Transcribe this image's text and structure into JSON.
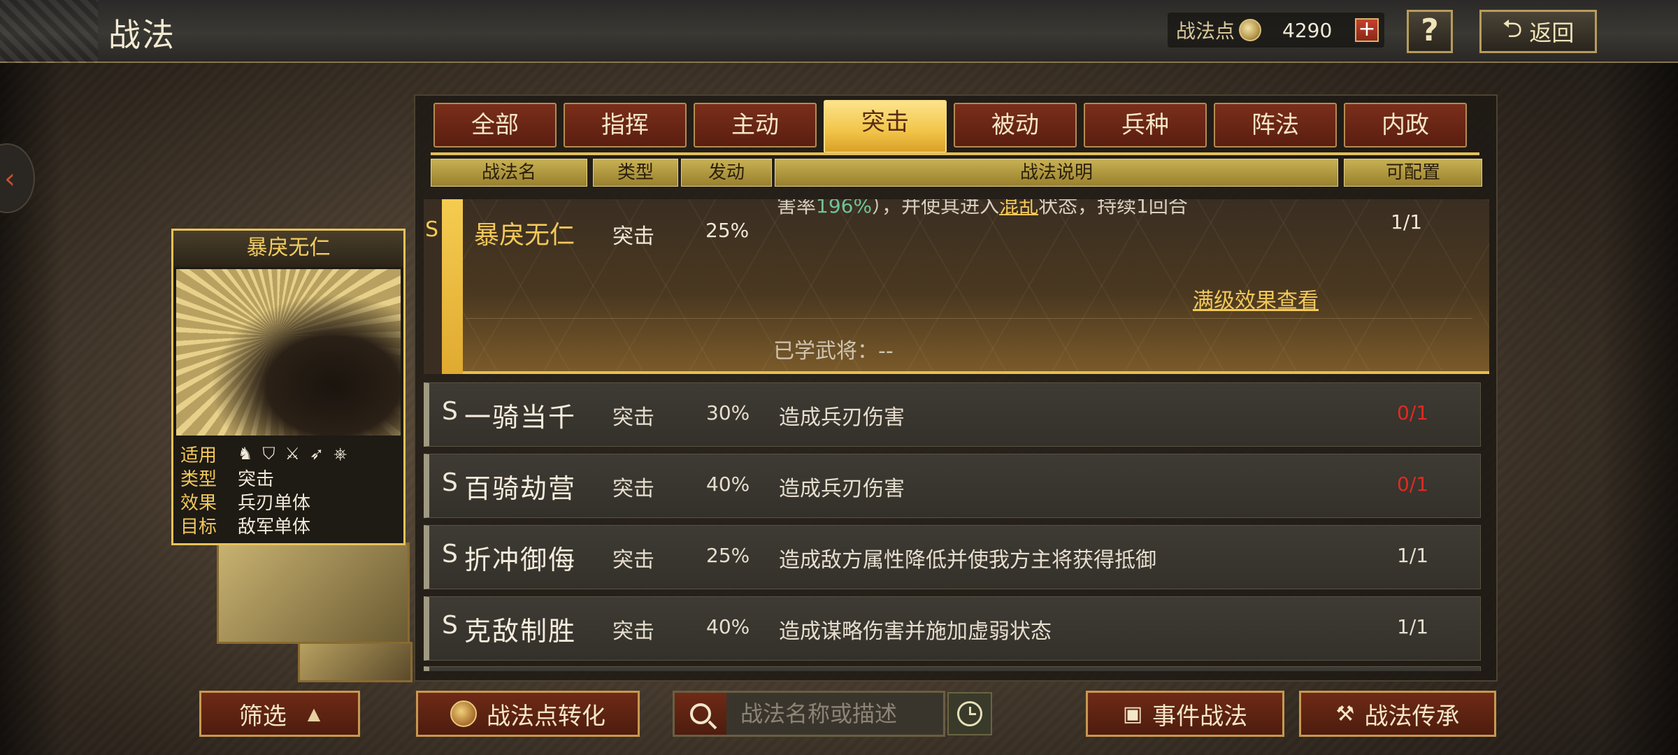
{
  "header": {
    "title": "战法",
    "points_label": "战法点",
    "points_value": "4290",
    "plus_label": "+",
    "help_label": "?",
    "back_label": "返回"
  },
  "tabs": [
    {
      "label": "全部"
    },
    {
      "label": "指挥"
    },
    {
      "label": "主动"
    },
    {
      "label": "突击",
      "active": true
    },
    {
      "label": "被动"
    },
    {
      "label": "兵种"
    },
    {
      "label": "阵法"
    },
    {
      "label": "内政"
    }
  ],
  "columns": {
    "name": "战法名",
    "type": "类型",
    "trigger": "发动",
    "desc": "战法说明",
    "config": "可配置"
  },
  "expanded": {
    "grade": "S",
    "name": "暴戾无仁",
    "type": "突击",
    "rate": "25%",
    "desc_a": "害率",
    "desc_pct": "196%",
    "desc_b": "），并使其进入",
    "desc_status": "混乱",
    "desc_c": "状态，持续1回合",
    "config": "1/1",
    "max_level_link": "满级效果查看",
    "learned_label": "已学武将：--"
  },
  "rows": [
    {
      "grade": "S",
      "name": "一骑当千",
      "type": "突击",
      "rate": "30%",
      "desc": "造成兵刃伤害",
      "config": "0/1"
    },
    {
      "grade": "S",
      "name": "百骑劫营",
      "type": "突击",
      "rate": "40%",
      "desc": "造成兵刃伤害",
      "config": "0/1"
    },
    {
      "grade": "S",
      "name": "折冲御侮",
      "type": "突击",
      "rate": "25%",
      "desc": "造成敌方属性降低并使我方主将获得抵御",
      "config": "1/1"
    },
    {
      "grade": "S",
      "name": "克敌制胜",
      "type": "突击",
      "rate": "40%",
      "desc": "造成谋略伤害并施加虚弱状态",
      "config": "1/1"
    }
  ],
  "card": {
    "title": "暴戾无仁",
    "apply_label": "适用",
    "type_label": "类型",
    "type_value": "突击",
    "effect_label": "效果",
    "effect_value": "兵刃单体",
    "target_label": "目标",
    "target_value": "敌军单体"
  },
  "bottom": {
    "filter_label": "筛选",
    "convert_label": "战法点转化",
    "search_placeholder": "战法名称或描述",
    "event_label": "事件战法",
    "inherit_label": "战法传承"
  },
  "colors": {
    "accent_gold": "#f2c85a",
    "tab_active": "#f1c448",
    "config_unavailable": "#e02a20"
  }
}
